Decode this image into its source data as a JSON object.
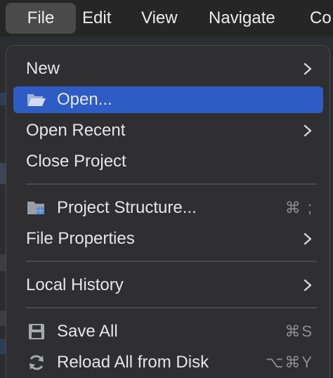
{
  "menubar": {
    "items": [
      {
        "label": "File",
        "active": true
      },
      {
        "label": "Edit"
      },
      {
        "label": "View"
      },
      {
        "label": "Navigate"
      },
      {
        "label": "Co"
      }
    ]
  },
  "file_menu": {
    "items": [
      {
        "label": "New",
        "submenu": true
      },
      {
        "label": "Open...",
        "icon": "folder-open-icon",
        "selected": true
      },
      {
        "label": "Open Recent",
        "submenu": true
      },
      {
        "label": "Close Project"
      },
      {
        "label": "Project Structure...",
        "icon": "project-structure-icon",
        "shortcut": "⌘ ;"
      },
      {
        "label": "File Properties",
        "submenu": true
      },
      {
        "label": "Local History",
        "submenu": true
      },
      {
        "label": "Save All",
        "icon": "save-icon",
        "shortcut": "⌘S"
      },
      {
        "label": "Reload All from Disk",
        "icon": "reload-icon",
        "shortcut": "⌥⌘Y"
      }
    ]
  },
  "colors": {
    "selection": "#2e5cc5",
    "menu_background": "#2f2f31",
    "menubar_background": "#262626",
    "menubar_active": "#4a4a4a",
    "icon_blue": "#4a8fe0"
  }
}
